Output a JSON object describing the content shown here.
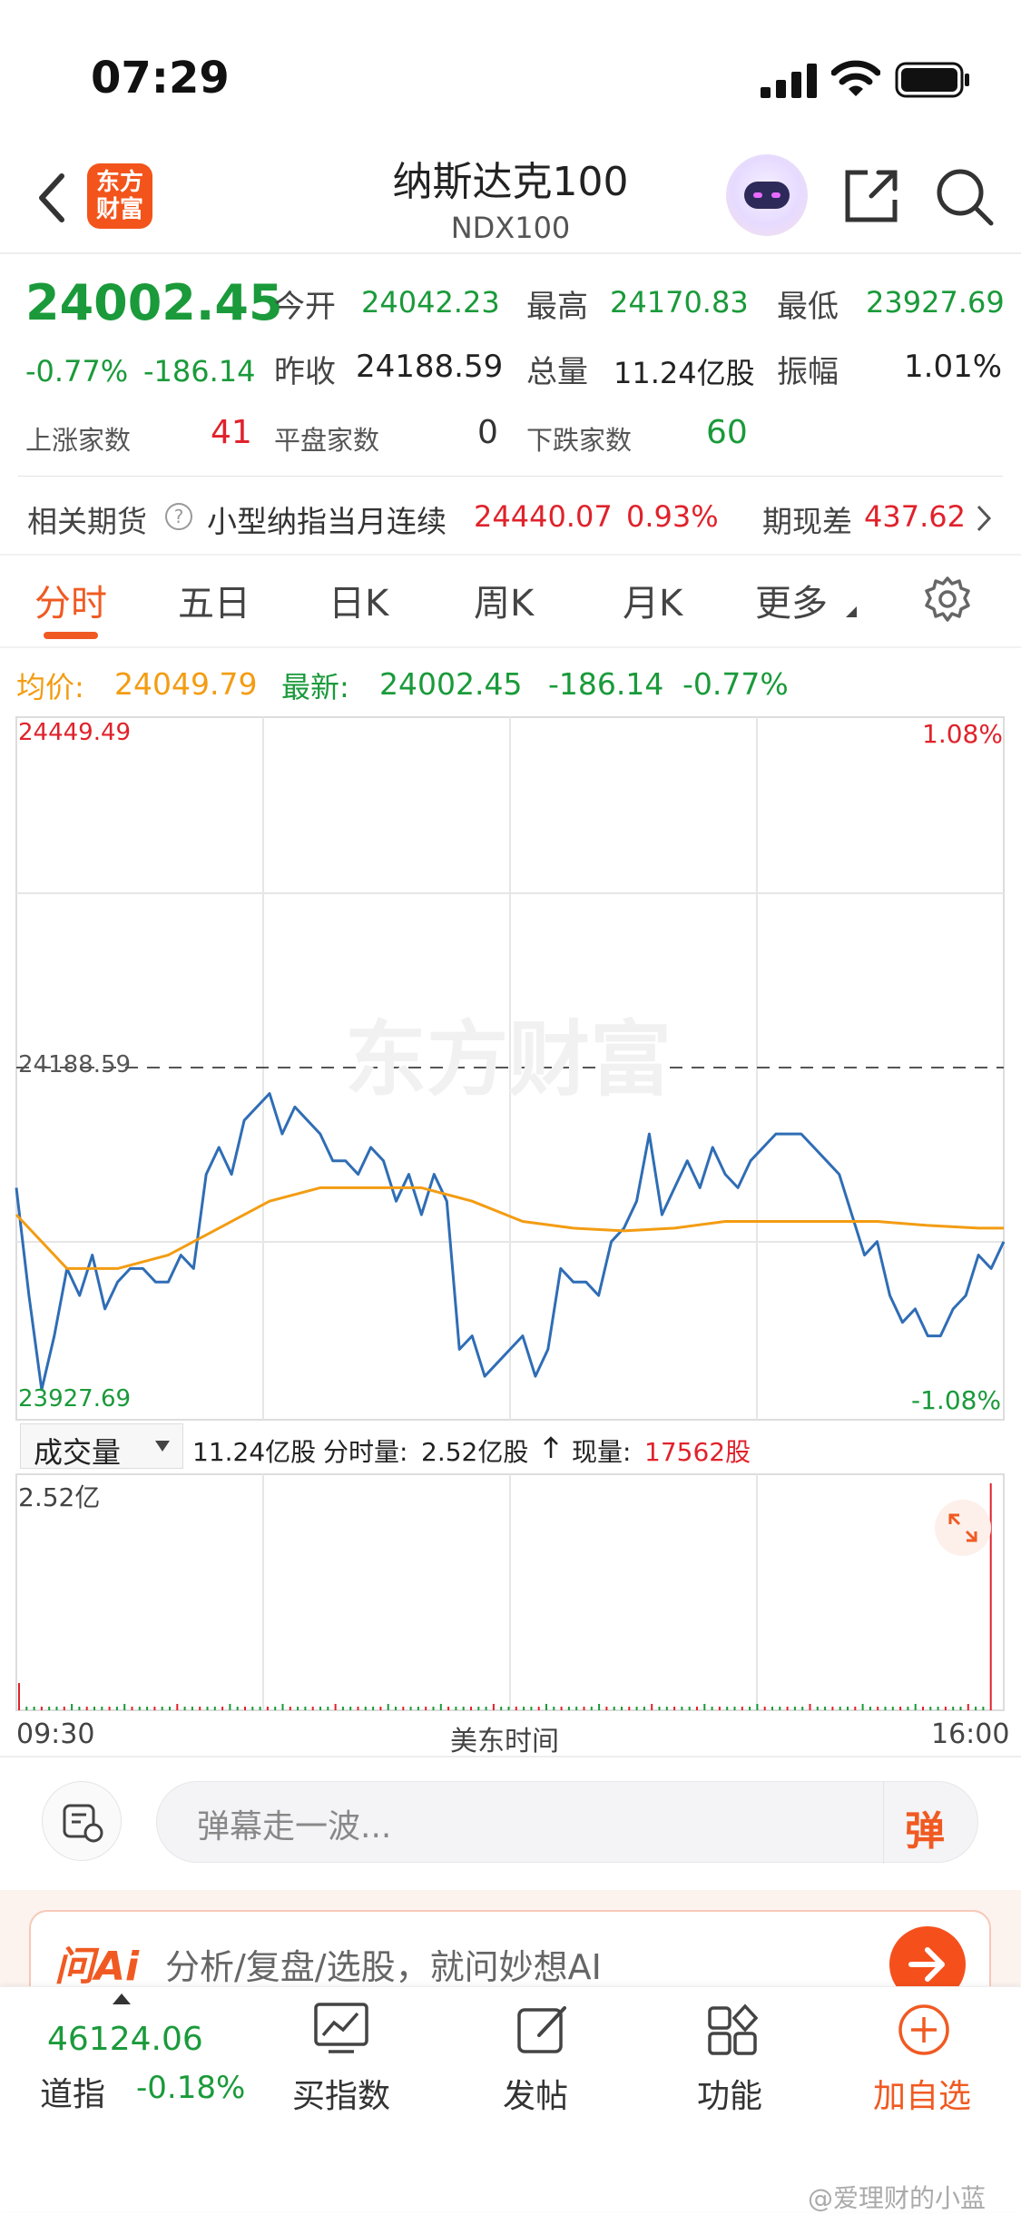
{
  "status": {
    "time": "07:29"
  },
  "header": {
    "logo": "东方\n财富",
    "title": "纳斯达克100",
    "subtitle": "NDX100",
    "icons": [
      "back-arrow-icon",
      "app-logo",
      "robot-avatar-icon",
      "share-icon",
      "search-icon"
    ]
  },
  "quote": {
    "price": "24002.45",
    "change_pct": "-0.77%",
    "change": "-186.14",
    "open_label": "今开",
    "open": "24042.23",
    "high_label": "最高",
    "high": "24170.83",
    "low_label": "最低",
    "low": "23927.69",
    "prev_label": "昨收",
    "prev": "24188.59",
    "vol_label": "总量",
    "vol": "11.24亿股",
    "amp_label": "振幅",
    "amp": "1.01%",
    "up_label": "上涨家数",
    "up": "41",
    "flat_label": "平盘家数",
    "flat": "0",
    "down_label": "下跌家数",
    "down": "60"
  },
  "futures": {
    "label": "相关期货",
    "name": "小型纳指当月连续",
    "price": "24440.07",
    "pct": "0.93%",
    "basis_label": "期现差",
    "basis": "437.62"
  },
  "tabs": [
    "分时",
    "五日",
    "日K",
    "周K",
    "月K",
    "更多"
  ],
  "avgline": {
    "avg_label": "均价:",
    "avg": "24049.79",
    "latest_label": "最新:",
    "latest": "24002.45",
    "chg": "-186.14",
    "pct": "-0.77%"
  },
  "chart": {
    "y_top": "24449.49",
    "y_mid": "24188.59",
    "y_bottom": "23927.69",
    "pct_top": "1.08%",
    "pct_bottom": "-1.08%",
    "watermark": "东方财富"
  },
  "volume": {
    "selector": "成交量",
    "total": "11.24亿股",
    "period_label": "分时量:",
    "period": "2.52亿股",
    "now_label": "现量:",
    "now": "17562股",
    "y_max": "2.52亿",
    "x_start": "09:30",
    "x_mid": "美东时间",
    "x_end": "16:00"
  },
  "danmu": {
    "placeholder": "弹幕走一波...",
    "button": "弹"
  },
  "ai": {
    "brand": "问Ai",
    "text": "分析/复盘/选股，就问妙想AI"
  },
  "bottom": {
    "index_value": "46124.06",
    "index_name": "道指",
    "index_pct": "-0.18%",
    "items": [
      "买指数",
      "发帖",
      "功能",
      "加自选"
    ]
  },
  "watermark": "@爱理财的小蓝",
  "chart_data": {
    "type": "line",
    "xlabel": "美东时间",
    "x_range": [
      "09:30",
      "16:00"
    ],
    "ylim": [
      23927.69,
      24449.49
    ],
    "reference": 24188.59,
    "series": [
      {
        "name": "最新",
        "x_minutes": [
          0,
          5,
          10,
          15,
          20,
          25,
          30,
          35,
          40,
          45,
          50,
          55,
          60,
          65,
          70,
          75,
          80,
          85,
          90,
          95,
          100,
          105,
          110,
          115,
          120,
          125,
          130,
          135,
          140,
          145,
          150,
          155,
          160,
          165,
          170,
          175,
          180,
          185,
          190,
          195,
          200,
          205,
          210,
          215,
          220,
          225,
          230,
          235,
          240,
          245,
          250,
          255,
          260,
          265,
          270,
          275,
          280,
          285,
          290,
          295,
          300,
          305,
          310,
          315,
          320,
          325,
          330,
          335,
          340,
          345,
          350,
          355,
          360,
          365,
          370,
          375,
          380,
          385,
          390
        ],
        "values": [
          24100,
          24020,
          23950,
          23990,
          24040,
          24020,
          24050,
          24010,
          24030,
          24040,
          24040,
          24030,
          24030,
          24050,
          24040,
          24110,
          24130,
          24110,
          24150,
          24160,
          24170,
          24140,
          24160,
          24150,
          24140,
          24120,
          24120,
          24110,
          24130,
          24120,
          24090,
          24110,
          24080,
          24110,
          24090,
          23980,
          23990,
          23960,
          23970,
          23980,
          23990,
          23960,
          23980,
          24040,
          24030,
          24030,
          24020,
          24060,
          24070,
          24090,
          24140,
          24080,
          24100,
          24120,
          24100,
          24130,
          24110,
          24100,
          24120,
          24130,
          24140,
          24140,
          24140,
          24130,
          24120,
          24110,
          24080,
          24050,
          24060,
          24020,
          24000,
          24010,
          23990,
          23990,
          24010,
          24020,
          24050,
          24040,
          24060
        ]
      },
      {
        "name": "均价",
        "x_minutes": [
          0,
          20,
          40,
          60,
          80,
          100,
          120,
          140,
          160,
          180,
          200,
          220,
          240,
          260,
          280,
          300,
          320,
          340,
          360,
          380,
          390
        ],
        "values": [
          24080,
          24040,
          24040,
          24050,
          24070,
          24090,
          24100,
          24100,
          24100,
          24090,
          24075,
          24070,
          24068,
          24070,
          24075,
          24075,
          24075,
          24075,
          24072,
          24070,
          24070
        ]
      }
    ]
  }
}
